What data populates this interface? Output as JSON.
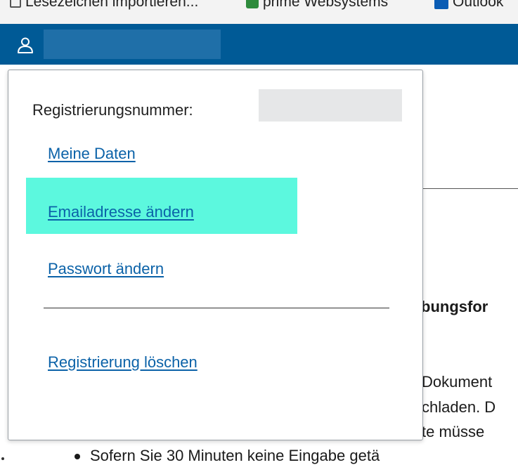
{
  "bookmarks": [
    {
      "label": "Lesezeichen importieren...",
      "icon": "bookmark-import-icon"
    },
    {
      "label": "prime Websystems",
      "icon": "excel-sheet-icon"
    },
    {
      "label": "Outlook",
      "icon": "outlook-icon"
    }
  ],
  "header": {
    "user_icon": "user-icon",
    "background_color": "#005a96"
  },
  "account_menu": {
    "registration_label": "Registrierungsnummer:",
    "items": [
      {
        "label": "Meine Daten"
      },
      {
        "label": "Emailadresse ändern",
        "highlighted": true
      },
      {
        "label": "Passwort ändern"
      },
      {
        "label": "Registrierung löschen"
      }
    ],
    "highlight_color": "#5cf8de",
    "link_color": "#0b62a8"
  },
  "page": {
    "heading_fragment": "bungsfor",
    "text_lines": [
      "Dokument",
      "chladen. D",
      "te müsse"
    ],
    "bullet_text": "Sofern Sie 30 Minuten keine Eingabe getä"
  }
}
